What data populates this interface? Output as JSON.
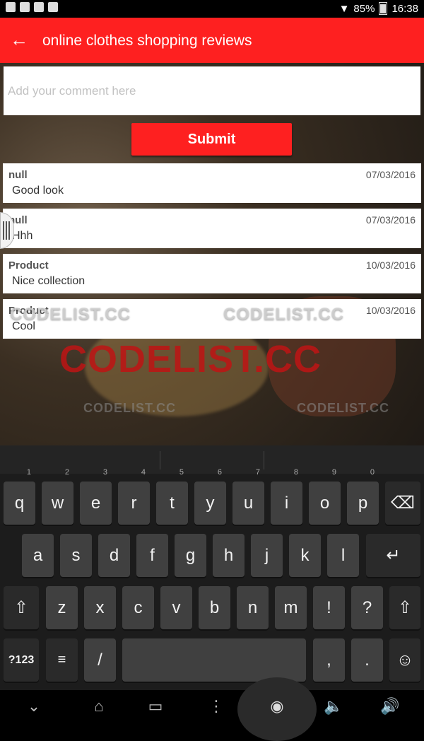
{
  "status_bar": {
    "battery": "85%",
    "time": "16:38"
  },
  "app_bar": {
    "back_icon": "arrow-left-icon",
    "title": "online clothes shopping reviews"
  },
  "form": {
    "comment_placeholder": "Add your comment here",
    "comment_value": "",
    "submit_label": "Submit"
  },
  "reviews": [
    {
      "author": "null",
      "date": "07/03/2016",
      "text": "Good look"
    },
    {
      "author": "null",
      "date": "07/03/2016",
      "text": "Hhh"
    },
    {
      "author": "Product",
      "date": "10/03/2016",
      "text": "Nice collection"
    },
    {
      "author": "Product",
      "date": "10/03/2016",
      "text": "Cool"
    }
  ],
  "watermark": {
    "text": "CODELIST.CC"
  },
  "keyboard": {
    "row1": [
      "q",
      "w",
      "e",
      "r",
      "t",
      "y",
      "u",
      "i",
      "o",
      "p"
    ],
    "row1_hints": [
      "1",
      "2",
      "3",
      "4",
      "5",
      "6",
      "7",
      "8",
      "9",
      "0"
    ],
    "row2": [
      "a",
      "s",
      "d",
      "f",
      "g",
      "h",
      "j",
      "k",
      "l"
    ],
    "row3": [
      "z",
      "x",
      "c",
      "v",
      "b",
      "n",
      "m",
      "!",
      "?"
    ],
    "sym_label": "?123",
    "slash": "/",
    "comma": ",",
    "period": "."
  },
  "colors": {
    "accent": "#fe2020",
    "watermark_red": "#be1414"
  }
}
